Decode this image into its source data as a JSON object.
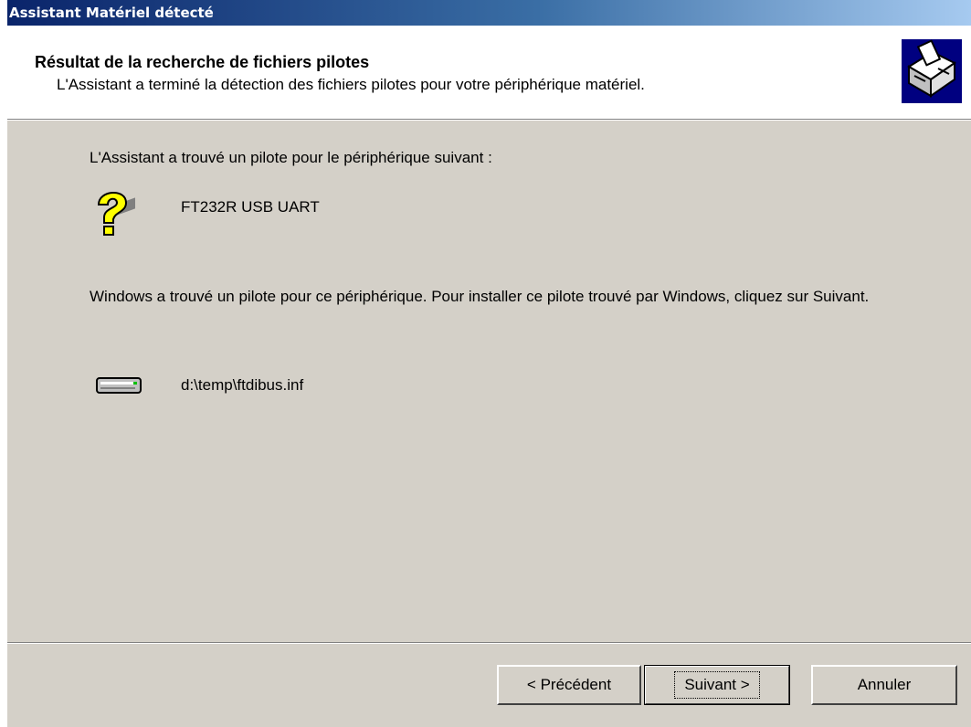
{
  "window": {
    "title": "Assistant Matériel détecté"
  },
  "header": {
    "title": "Résultat de la recherche de fichiers pilotes",
    "subtitle": "L'Assistant a terminé la détection des fichiers pilotes pour votre périphérique matériel."
  },
  "content": {
    "intro": "L'Assistant a trouvé un pilote pour le périphérique suivant :",
    "device_name": "FT232R USB UART",
    "message": "Windows a trouvé un pilote pour ce périphérique. Pour installer ce pilote trouvé par Windows, cliquez sur Suivant.",
    "driver_path": "d:\\temp\\ftdibus.inf"
  },
  "buttons": {
    "back": "< Précédent",
    "next": "Suivant >",
    "cancel": "Annuler"
  },
  "icons": {
    "header": "hardware-wizard-icon",
    "device": "unknown-device-icon",
    "drive": "disk-drive-icon"
  }
}
